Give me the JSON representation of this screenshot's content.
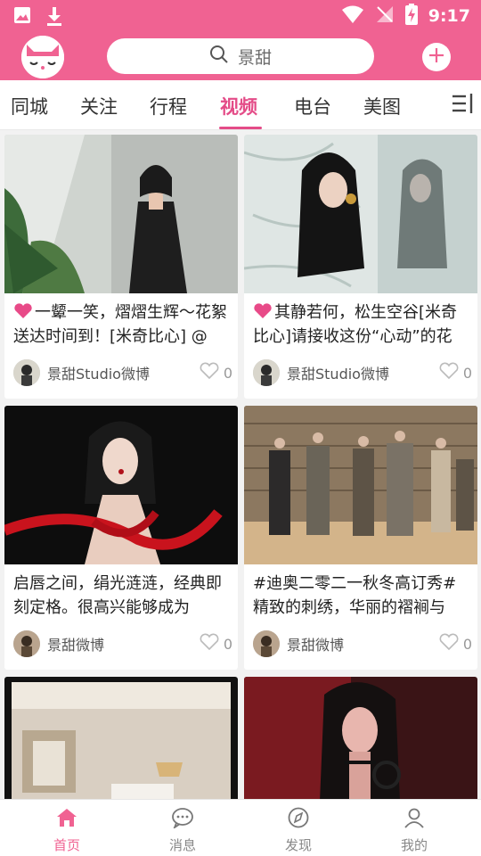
{
  "status_bar": {
    "time": "9:17"
  },
  "header": {
    "search_text": "景甜"
  },
  "tabs": [
    {
      "label": "同城"
    },
    {
      "label": "关注"
    },
    {
      "label": "行程"
    },
    {
      "label": "视频",
      "active": true
    },
    {
      "label": "电台"
    },
    {
      "label": "美图"
    }
  ],
  "cards": [
    {
      "caption": "一颦一笑，熠熠生辉～花絮送达时间到！[米奇比心] @",
      "caption_has_heart": true,
      "author": "景甜Studio微博",
      "likes": "0"
    },
    {
      "caption": "其静若何，松生空谷[米奇比心]请接收这份“心动”的花",
      "caption_has_heart": true,
      "author": "景甜Studio微博",
      "likes": "0"
    },
    {
      "caption": "启唇之间，绢光涟涟，经典即刻定格。很高兴能够成为",
      "caption_has_heart": false,
      "author": "景甜微博",
      "likes": "0"
    },
    {
      "caption": "#迪奥二零二一秋冬高订秀#精致的刺绣，华丽的褶裥与",
      "caption_has_heart": false,
      "author": "景甜微博",
      "likes": "0"
    }
  ],
  "bottom_nav": [
    {
      "label": "首页",
      "active": true
    },
    {
      "label": "消息"
    },
    {
      "label": "发现"
    },
    {
      "label": "我的"
    }
  ],
  "colors": {
    "brand_pink": "#f06292",
    "active_tab": "#e44c88",
    "heart": "#e84a88"
  }
}
